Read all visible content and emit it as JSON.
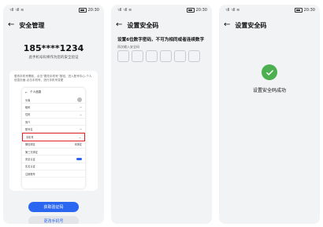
{
  "status_bar": {
    "signal": "ᴴᵈ𝗂𝗅 ᴴᵈ𝗂𝗅 ≋",
    "time": "20:30"
  },
  "screen1": {
    "title": "安全管理",
    "phone": "185****1234",
    "subtitle": "此手机号码将作为您的安全验证",
    "tip": "更改手机号需前，点击“更改手机号”按钮，进入账号中心-个人信息页面-点击手机号，进行手机号变更",
    "mini_title": "个人信息",
    "mini_rows": [
      {
        "label": "头像",
        "value": ""
      },
      {
        "label": "昵称",
        "value": "—"
      },
      {
        "label": "性别",
        "value": "—"
      },
      {
        "label": "简介",
        "value": ""
      },
      {
        "label": "账号名",
        "value": "—"
      },
      {
        "label": "手机号",
        "value": "—"
      },
      {
        "label": "微信绑定",
        "value": "未绑定"
      },
      {
        "label": "第三方绑定",
        "value": ""
      },
      {
        "label": "安全认证",
        "value": ""
      },
      {
        "label": "实名认证",
        "value": ""
      },
      {
        "label": "注销账号",
        "value": ""
      }
    ],
    "primary_button": "获取验证码",
    "secondary_button": "更改手机号"
  },
  "screen2": {
    "title": "设置安全码",
    "instruction": "设置6位数字密码，不可为相同或者连续数字",
    "hint": "再次输入安全码"
  },
  "screen3": {
    "title": "设置安全码",
    "success": "设置安全码成功"
  },
  "colors": {
    "primary": "#2a66f0",
    "success": "#4caf50",
    "highlight": "#e02424"
  }
}
